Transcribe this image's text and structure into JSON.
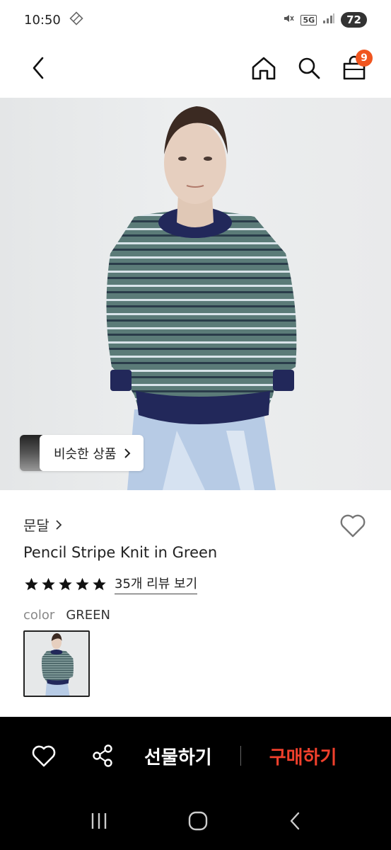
{
  "status_bar": {
    "time": "10:50",
    "network": "5G",
    "battery": "72"
  },
  "header": {
    "cart_count": "9"
  },
  "hero": {
    "similar_label": "비슷한 상품"
  },
  "product": {
    "brand": "문달",
    "name": "Pencil Stripe Knit in Green",
    "rating_stars": 5,
    "review_link": "35개 리뷰 보기",
    "color_label": "color",
    "color_value": "GREEN"
  },
  "actions": {
    "gift_label": "선물하기",
    "buy_label": "구매하기"
  },
  "colors": {
    "accent": "#f0402c",
    "badge": "#f0551f"
  }
}
